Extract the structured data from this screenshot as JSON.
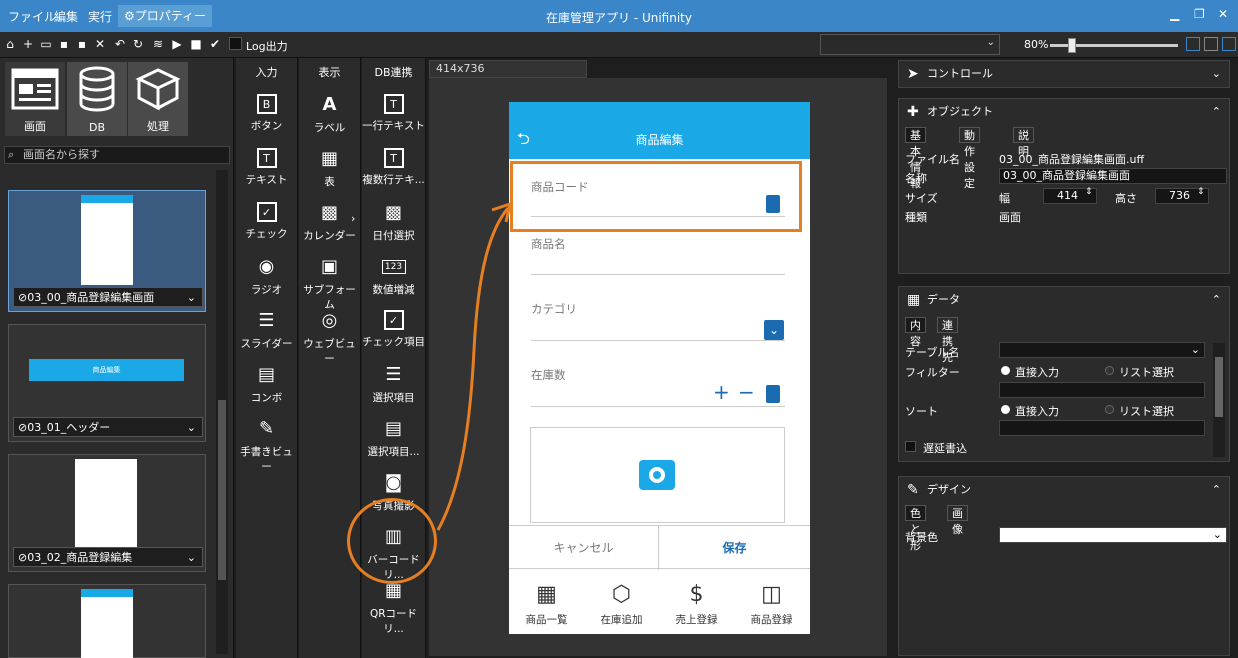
{
  "titlebar": {
    "menus": [
      "ファイル",
      "編集",
      "実行"
    ],
    "properties_menu": "プロパティー",
    "title": "在庫管理アプリ - Unifinity",
    "min_icon": "minimize-icon",
    "max_icon": "maximize-icon",
    "close_icon": "close-icon"
  },
  "toolbar": {
    "log_label": "Log出力",
    "zoom_label": "80%",
    "zoom_level": 0.15
  },
  "left": {
    "tabs": [
      {
        "label": "画面",
        "icon": "screen-icon"
      },
      {
        "label": "DB",
        "icon": "database-icon"
      },
      {
        "label": "処理",
        "icon": "blocks-icon"
      }
    ],
    "search_placeholder": "画面名から探す",
    "screens": [
      {
        "name": "03_00_商品登録編集画面",
        "selected": true
      },
      {
        "name": "03_01_ヘッダー",
        "selected": false
      },
      {
        "name": "03_02_商品登録編集",
        "selected": false
      }
    ],
    "header_preview_text": "商品編集"
  },
  "palette": {
    "input": {
      "heading": "入力",
      "items": [
        "ボタン",
        "テキスト",
        "チェック",
        "ラジオ",
        "スライダー",
        "コンボ",
        "手書きビュー"
      ]
    },
    "display": {
      "heading": "表示",
      "items": [
        "ラベル",
        "表",
        "カレンダー",
        "サブフォーム",
        "ウェブビュー"
      ]
    },
    "db": {
      "heading": "DB連携",
      "items": [
        "一行テキスト",
        "複数行テキ...",
        "日付選択",
        "数値増減",
        "チェック項目",
        "選択項目",
        "選択項目...",
        "写真撮影",
        "バーコードリ...",
        "QRコードリ..."
      ]
    }
  },
  "canvas": {
    "tab": "414x736",
    "phone": {
      "title": "商品編集",
      "fields": [
        "商品コード",
        "商品名",
        "カテゴリ",
        "在庫数"
      ],
      "cancel": "キャンセル",
      "save": "保存",
      "tabs": [
        "商品一覧",
        "在庫追加",
        "売上登録",
        "商品登録"
      ]
    }
  },
  "right": {
    "control": {
      "title": "コントロール"
    },
    "object": {
      "title": "オブジェクト",
      "tabs": [
        "基本情報",
        "動作設定",
        "説明"
      ],
      "filename_label": "ファイル名",
      "filename_value": "03_00_商品登録編集画面.uff",
      "name_label": "名称",
      "name_value": "03_00_商品登録編集画面",
      "size_label": "サイズ",
      "width_label": "幅",
      "width_value": "414",
      "height_label": "高さ",
      "height_value": "736",
      "type_label": "種類",
      "type_value": "画面"
    },
    "data": {
      "title": "データ",
      "tabs": [
        "内容",
        "連携先"
      ],
      "table_label": "テーブル名",
      "filter_label": "フィルター",
      "sort_label": "ソート",
      "direct": "直接入力",
      "list": "リスト選択",
      "lazy_write": "遅延書込"
    },
    "design": {
      "title": "デザイン",
      "tabs": [
        "色と形",
        "画像"
      ],
      "bg_label": "背景色"
    }
  },
  "colors": {
    "accent": "#1aa9e6",
    "titlebar": "#3a86c8",
    "highlight": "#e67e22",
    "button_blue": "#1a6bb0"
  }
}
